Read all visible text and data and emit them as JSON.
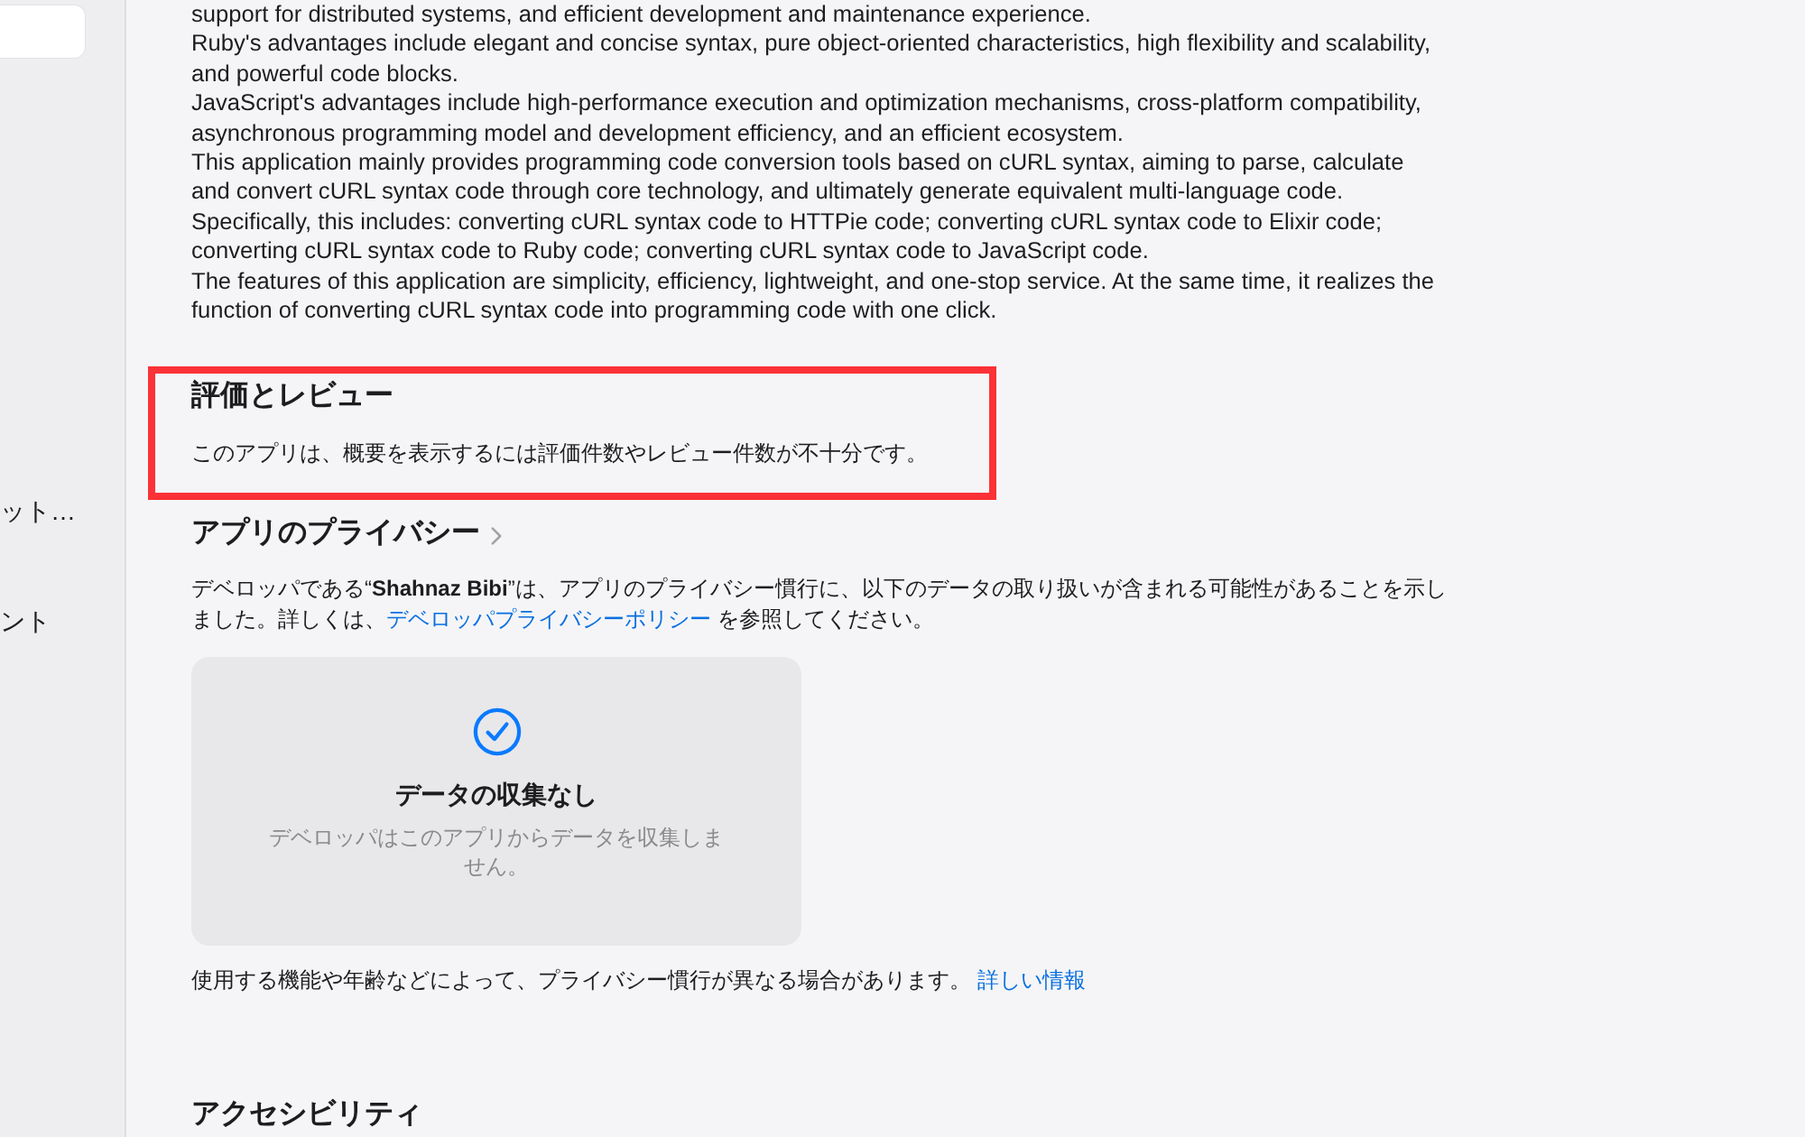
{
  "sidebar": {
    "items": [
      {
        "label": "ット…"
      },
      {
        "label": "ント"
      }
    ]
  },
  "description": {
    "paragraphs": [
      "support for distributed systems, and efficient development and maintenance experience.",
      "Ruby's advantages include elegant and concise syntax, pure object-oriented characteristics, high flexibility and scalability, and powerful code blocks.",
      "JavaScript's advantages include high-performance execution and optimization mechanisms, cross-platform compatibility, asynchronous programming model and development efficiency, and an efficient ecosystem.",
      "This application mainly provides programming code conversion tools based on cURL syntax, aiming to parse, calculate and convert cURL syntax code through core technology, and ultimately generate equivalent multi-language code. Specifically, this includes: converting cURL syntax code to HTTPie code; converting cURL syntax code to Elixir code; converting cURL syntax code to Ruby code; converting cURL syntax code to JavaScript code.",
      "The features of this application are simplicity, efficiency, lightweight, and one-stop service. At the same time, it realizes the function of converting cURL syntax code into programming code with one click."
    ]
  },
  "ratings": {
    "title": "評価とレビュー",
    "message": "このアプリは、概要を表示するには評価件数やレビュー件数が不十分です。",
    "highlighted": true
  },
  "privacy": {
    "title": "アプリのプライバシー",
    "intro": "デベロッパである“**Shahnaz Bibi**”は、アプリのプライバシー慣行に、以下のデータの取り扱いが含まれる可能性があることを示しました。詳しくは、",
    "policy_link": "デベロッパプライバシーポリシー",
    "intro_end": "を参照してください。",
    "card": {
      "title": "データの収集なし",
      "text": "デベロッパはこのアプリからデータを収集しません。"
    },
    "note": "使用する機能や年齢などによって、プライバシー慣行が異なる場合があります。",
    "note_link": "詳しい情報"
  },
  "accessibility": {
    "title": "アクセシビリティ"
  }
}
